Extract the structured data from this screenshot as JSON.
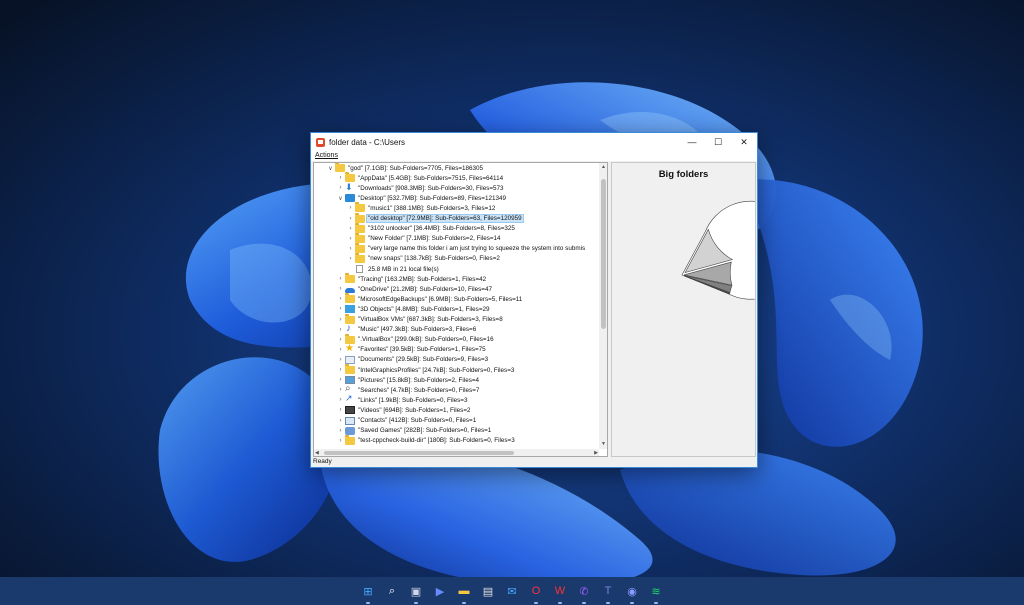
{
  "window": {
    "title": "folder data - C:\\Users",
    "minimize": "—",
    "maximize": "☐",
    "close": "✕"
  },
  "menu": {
    "actions": "Actions"
  },
  "tree": {
    "rows": [
      {
        "depth": 0,
        "expand": "∨",
        "icon": "folder-icon",
        "text": "\"god\" [7.1GB]: Sub-Folders=7705, Files=186305"
      },
      {
        "depth": 1,
        "expand": "›",
        "icon": "folder-icon",
        "text": "\"AppData\" [5.4GB]: Sub-Folders=7515, Files=64114"
      },
      {
        "depth": 1,
        "expand": "›",
        "icon": "downloads-icon",
        "text": "\"Downloads\" [908.3MB]: Sub-Folders=30, Files=573"
      },
      {
        "depth": 1,
        "expand": "∨",
        "icon": "desktop-icon",
        "text": "\"Desktop\" [532.7MB]: Sub-Folders=89, Files=121349"
      },
      {
        "depth": 2,
        "expand": "›",
        "icon": "folder-icon",
        "text": "\"music1\" [388.1MB]: Sub-Folders=3, Files=12"
      },
      {
        "depth": 2,
        "expand": "›",
        "icon": "folder-icon",
        "text": "\"old desktop\" [72.9MB]: Sub-Folders=63, Files=120959",
        "selected": true
      },
      {
        "depth": 2,
        "expand": "›",
        "icon": "folder-icon",
        "text": "\"3102 unlocker\" [36.4MB]: Sub-Folders=8, Files=325"
      },
      {
        "depth": 2,
        "expand": "›",
        "icon": "folder-icon",
        "text": "\"New Folder\" [7.1MB]: Sub-Folders=2, Files=14"
      },
      {
        "depth": 2,
        "expand": "›",
        "icon": "folder-icon",
        "text": "\"very large name this folder i am just trying to squeeze the system into submis"
      },
      {
        "depth": 2,
        "expand": "›",
        "icon": "folder-icon",
        "text": "\"new snaps\" [138.7kB]: Sub-Folders=0, Files=2"
      },
      {
        "depth": 2,
        "expand": "",
        "icon": "file-icon",
        "text": "25.8 MB in 21 local file(s)"
      },
      {
        "depth": 1,
        "expand": "›",
        "icon": "folder-icon",
        "text": "\"Tracing\" [163.2MB]: Sub-Folders=1, Files=42"
      },
      {
        "depth": 1,
        "expand": "›",
        "icon": "onedrive-icon",
        "text": "\"OneDrive\" [21.2MB]: Sub-Folders=10, Files=47"
      },
      {
        "depth": 1,
        "expand": "›",
        "icon": "folder-icon",
        "text": "\"MicrosoftEdgeBackups\" [6.9MB]: Sub-Folders=5, Files=11"
      },
      {
        "depth": 1,
        "expand": "›",
        "icon": "3d-objects-icon",
        "text": "\"3D Objects\" [4.8MB]: Sub-Folders=1, Files=29"
      },
      {
        "depth": 1,
        "expand": "›",
        "icon": "folder-icon",
        "text": "\"VirtualBox VMs\" [687.3kB]: Sub-Folders=3, Files=8"
      },
      {
        "depth": 1,
        "expand": "›",
        "icon": "music-icon",
        "text": "\"Music\" [497.3kB]: Sub-Folders=3, Files=6"
      },
      {
        "depth": 1,
        "expand": "›",
        "icon": "folder-icon",
        "text": "\".VirtualBox\" [299.0kB]: Sub-Folders=0, Files=16"
      },
      {
        "depth": 1,
        "expand": "›",
        "icon": "favorites-icon",
        "text": "\"Favorites\" [39.5kB]: Sub-Folders=1, Files=75"
      },
      {
        "depth": 1,
        "expand": "›",
        "icon": "documents-icon",
        "text": "\"Documents\" [29.5kB]: Sub-Folders=9, Files=3"
      },
      {
        "depth": 1,
        "expand": "›",
        "icon": "folder-icon",
        "text": "\"IntelGraphicsProfiles\" [24.7kB]: Sub-Folders=0, Files=3"
      },
      {
        "depth": 1,
        "expand": "›",
        "icon": "pictures-icon",
        "text": "\"Pictures\" [15.8kB]: Sub-Folders=2, Files=4"
      },
      {
        "depth": 1,
        "expand": "›",
        "icon": "searches-icon",
        "text": "\"Searches\" [4.7kB]: Sub-Folders=0, Files=7"
      },
      {
        "depth": 1,
        "expand": "›",
        "icon": "links-icon",
        "text": "\"Links\" [1.9kB]: Sub-Folders=0, Files=3"
      },
      {
        "depth": 1,
        "expand": "›",
        "icon": "videos-icon",
        "text": "\"Videos\" [694B]: Sub-Folders=1, Files=2"
      },
      {
        "depth": 1,
        "expand": "›",
        "icon": "contacts-icon",
        "text": "\"Contacts\" [412B]: Sub-Folders=0, Files=1"
      },
      {
        "depth": 1,
        "expand": "›",
        "icon": "saved-games-icon",
        "text": "\"Saved Games\" [282B]: Sub-Folders=0, Files=1"
      },
      {
        "depth": 1,
        "expand": "›",
        "icon": "folder-icon",
        "text": "\"test-cppcheck-build-dir\" [180B]: Sub-Folders=0, Files=3"
      }
    ]
  },
  "chart_title": "Big folders",
  "chart_data": {
    "type": "pie",
    "title": "Big folders",
    "slices": [
      {
        "value": 5.4,
        "color": "#ffffff"
      },
      {
        "value": 0.908,
        "color": "#d2d2d2"
      },
      {
        "value": 0.533,
        "color": "#a8a8a8"
      },
      {
        "value": 0.163,
        "color": "#808080"
      },
      {
        "value": 0.021,
        "color": "#5a5a5a"
      },
      {
        "value": 0.0069,
        "color": "#3a3a3a"
      },
      {
        "value": 0.0048,
        "color": "#222222"
      }
    ]
  },
  "status": "Ready",
  "scroll": {
    "up": "▲",
    "down": "▼",
    "left": "◀",
    "right": "▶"
  },
  "taskbar": {
    "icons": [
      {
        "name": "start-icon",
        "glyph": "⊞",
        "color": "#4aa8ff"
      },
      {
        "name": "search-icon",
        "glyph": "⌕",
        "color": "#ffffff"
      },
      {
        "name": "task-view-icon",
        "glyph": "▣",
        "color": "#d0d8e8"
      },
      {
        "name": "meet-icon",
        "glyph": "▶",
        "color": "#6a8aff"
      },
      {
        "name": "file-explorer-icon",
        "glyph": "▬",
        "color": "#f5c842"
      },
      {
        "name": "store-icon",
        "glyph": "▤",
        "color": "#e0e0e0"
      },
      {
        "name": "mail-icon",
        "glyph": "✉",
        "color": "#4aa8ff"
      },
      {
        "name": "opera-icon",
        "glyph": "O",
        "color": "#ff3040"
      },
      {
        "name": "wps-icon",
        "glyph": "W",
        "color": "#ff3030"
      },
      {
        "name": "messenger-icon",
        "glyph": "✆",
        "color": "#a060ff"
      },
      {
        "name": "teams-icon",
        "glyph": "T",
        "color": "#7a80e0"
      },
      {
        "name": "discord-icon",
        "glyph": "◉",
        "color": "#8a9aff"
      },
      {
        "name": "spotify-icon",
        "glyph": "≋",
        "color": "#1ed760"
      }
    ]
  }
}
